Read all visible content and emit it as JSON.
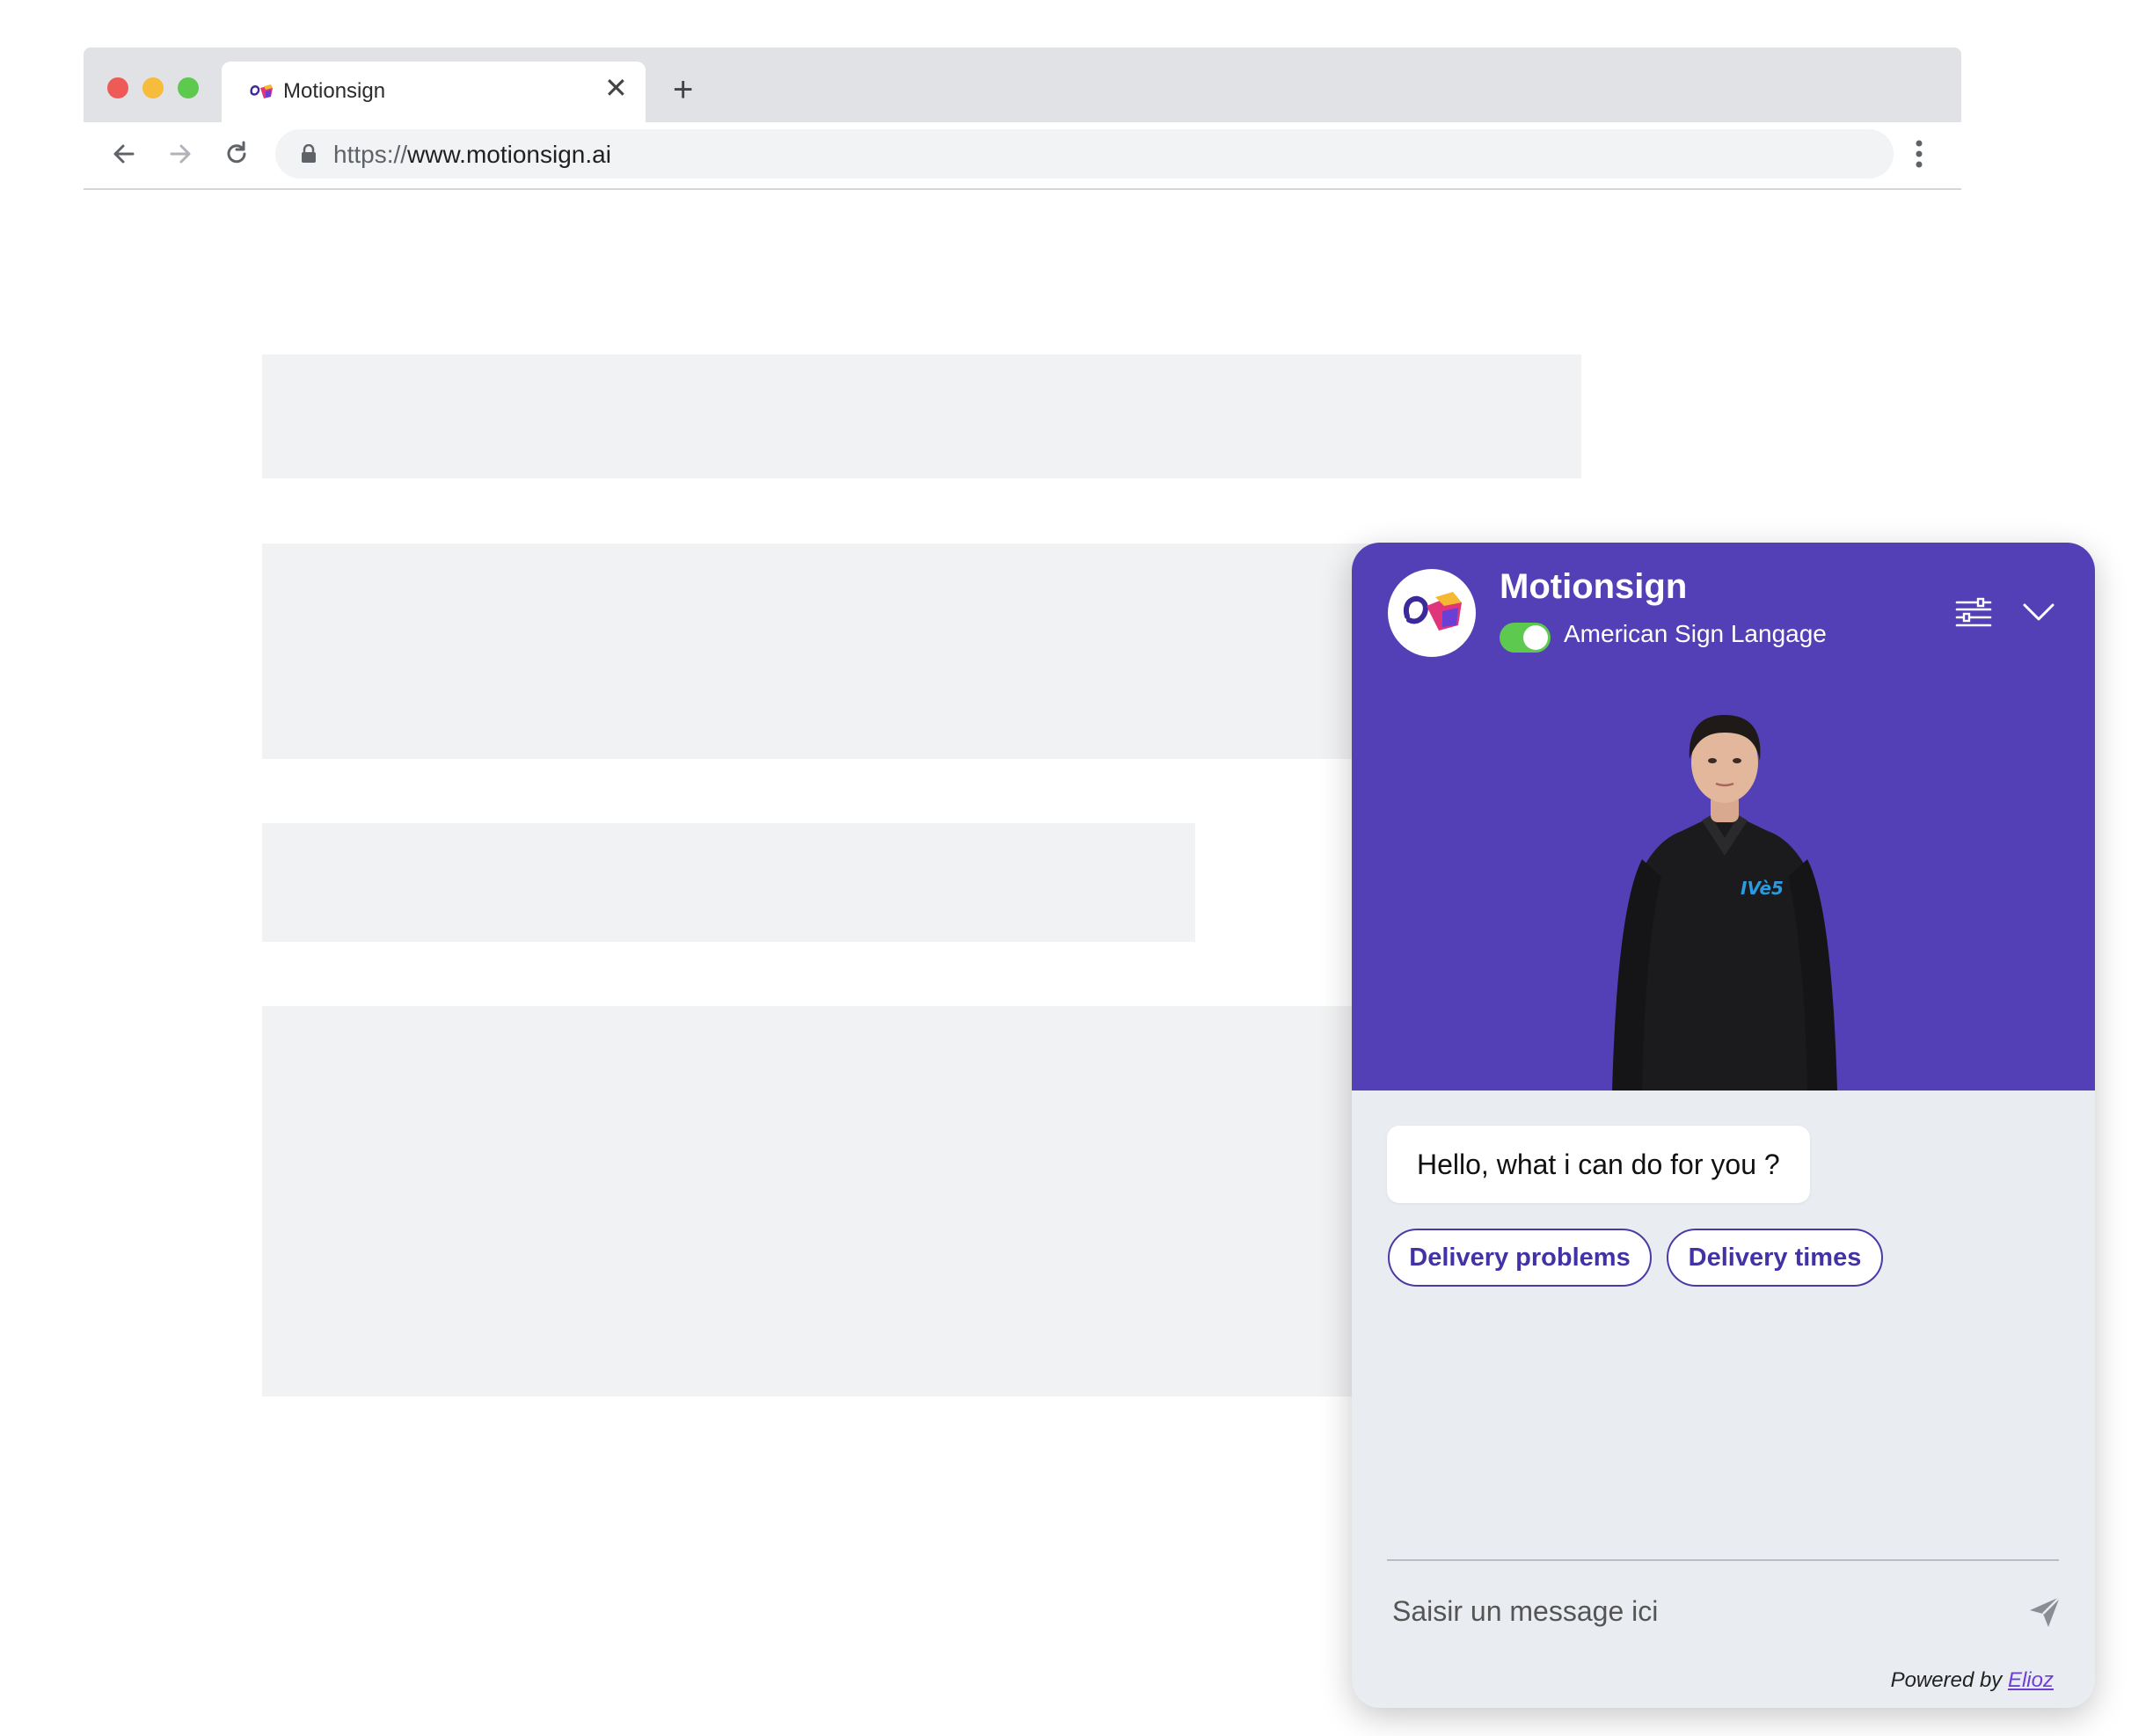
{
  "browser": {
    "tab_title": "Motionsign",
    "url_scheme": "https://",
    "url_host": "www.motionsign.ai",
    "icons": [
      "favicon-icon",
      "close-icon",
      "plus-icon",
      "back-icon",
      "forward-icon",
      "reload-icon",
      "lock-icon",
      "menu-dots-icon"
    ]
  },
  "widget": {
    "title": "Motionsign",
    "language": "American Sign Langage",
    "toggle_on": true,
    "accent_color": "#5340b6",
    "toggle_color": "#5ec94f",
    "greeting": "Hello, what i can do for you ?",
    "quick_replies": [
      "Delivery problems",
      "Delivery times"
    ],
    "input_placeholder": "Saisir un message ici",
    "powered_by_prefix": "Powered by ",
    "powered_by_link": "Elioz",
    "icons": [
      "logo-icon",
      "settings-sliders-icon",
      "chevron-down-icon",
      "send-icon"
    ]
  }
}
